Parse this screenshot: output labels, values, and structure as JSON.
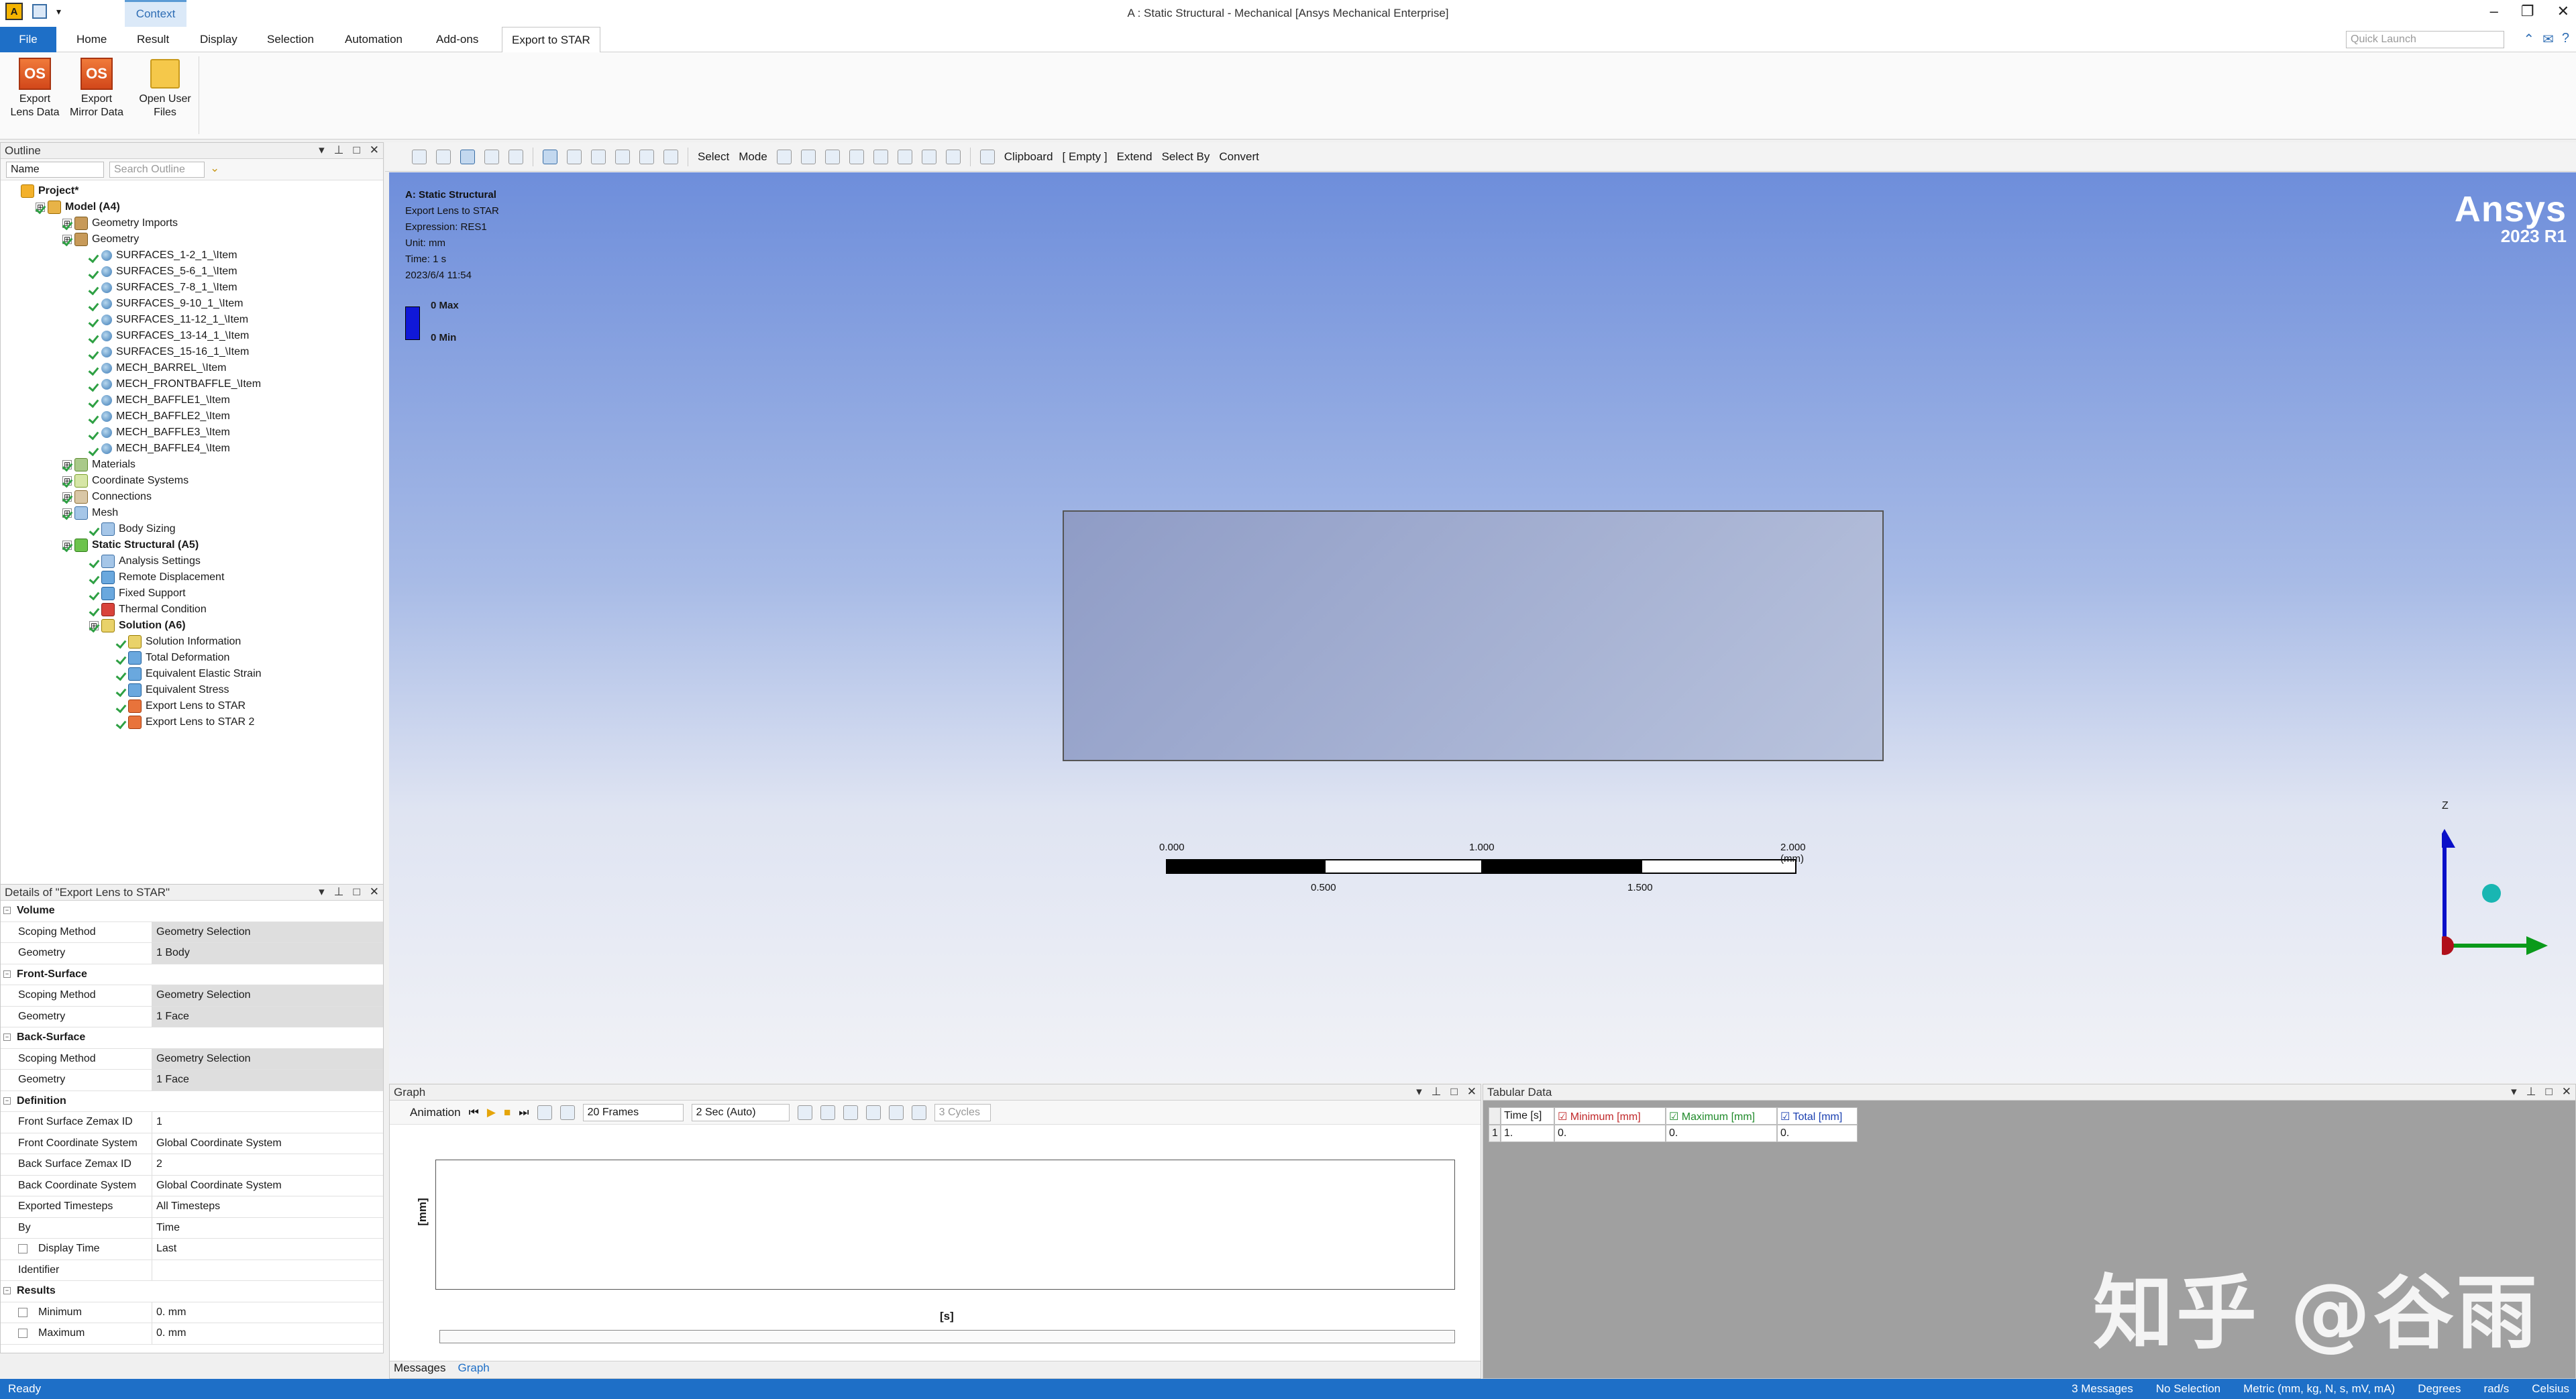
{
  "window": {
    "title": "A : Static Structural - Mechanical [Ansys Mechanical Enterprise]",
    "context_tab": "Context"
  },
  "ribbon_tabs": [
    "File",
    "Home",
    "Result",
    "Display",
    "Selection",
    "Automation",
    "Add-ons",
    "Export to STAR"
  ],
  "quick_launch_placeholder": "Quick Launch",
  "ribbon": {
    "btn1_l1": "Export",
    "btn1_l2": "Lens Data",
    "btn2_l1": "Export",
    "btn2_l2": "Mirror Data",
    "btn3_l1": "Open User",
    "btn3_l2": "Files",
    "os_icon": "OS"
  },
  "outline": {
    "title": "Outline",
    "filter_name": "Name",
    "search_placeholder": "Search Outline",
    "items": [
      "Project*",
      "Model (A4)",
      "Geometry Imports",
      "Geometry",
      "SURFACES_1-2_1_\\Item",
      "SURFACES_5-6_1_\\Item",
      "SURFACES_7-8_1_\\Item",
      "SURFACES_9-10_1_\\Item",
      "SURFACES_11-12_1_\\Item",
      "SURFACES_13-14_1_\\Item",
      "SURFACES_15-16_1_\\Item",
      "MECH_BARREL_\\Item",
      "MECH_FRONTBAFFLE_\\Item",
      "MECH_BAFFLE1_\\Item",
      "MECH_BAFFLE2_\\Item",
      "MECH_BAFFLE3_\\Item",
      "MECH_BAFFLE4_\\Item",
      "Materials",
      "Coordinate Systems",
      "Connections",
      "Mesh",
      "Body Sizing",
      "Static Structural (A5)",
      "Analysis Settings",
      "Remote Displacement",
      "Fixed Support",
      "Thermal Condition",
      "Solution (A6)",
      "Solution Information",
      "Total Deformation",
      "Equivalent Elastic Strain",
      "Equivalent Stress",
      "Export Lens to STAR",
      "Export Lens to STAR 2"
    ]
  },
  "details": {
    "title": "Details of \"Export Lens to STAR\"",
    "rows": [
      {
        "k": "Volume",
        "v": ""
      },
      {
        "k": "Scoping Method",
        "v": "Geometry Selection"
      },
      {
        "k": "Geometry",
        "v": "1 Body"
      },
      {
        "k": "Front-Surface",
        "v": ""
      },
      {
        "k": "Scoping Method",
        "v": "Geometry Selection"
      },
      {
        "k": "Geometry",
        "v": "1 Face"
      },
      {
        "k": "Back-Surface",
        "v": ""
      },
      {
        "k": "Scoping Method",
        "v": "Geometry Selection"
      },
      {
        "k": "Geometry",
        "v": "1 Face"
      },
      {
        "k": "Definition",
        "v": ""
      },
      {
        "k": "Front Surface Zemax ID",
        "v": "1"
      },
      {
        "k": "Front Coordinate System",
        "v": "Global Coordinate System"
      },
      {
        "k": "Back Surface Zemax ID",
        "v": "2"
      },
      {
        "k": "Back Coordinate System",
        "v": "Global Coordinate System"
      },
      {
        "k": "Exported Timesteps",
        "v": "All Timesteps"
      },
      {
        "k": "By",
        "v": "Time"
      },
      {
        "k": "Display Time",
        "v": "Last"
      },
      {
        "k": "Identifier",
        "v": ""
      },
      {
        "k": "Results",
        "v": ""
      },
      {
        "k": "Minimum",
        "v": "0. mm"
      },
      {
        "k": "Maximum",
        "v": "0. mm"
      }
    ]
  },
  "toolbar": {
    "select": "Select",
    "mode": "Mode",
    "clipboard": "Clipboard",
    "empty": "[ Empty ]",
    "extend": "Extend",
    "select_by": "Select By",
    "convert": "Convert"
  },
  "viewport": {
    "info": [
      "A: Static Structural",
      "Export Lens to STAR",
      "Expression: RES1",
      "Unit: mm",
      "Time: 1 s",
      "2023/6/4 11:54"
    ],
    "legend_max": "0 Max",
    "legend_min": "0 Min",
    "brand": "Ansys",
    "version": "2023 R1",
    "scale_labels": [
      "0.000",
      "1.000",
      "2.000 (mm)",
      "0.500",
      "1.500"
    ],
    "axis_z": "Z"
  },
  "graph": {
    "title": "Graph",
    "animation": "Animation",
    "frames": "20 Frames",
    "duration": "2 Sec (Auto)",
    "cycles": "3 Cycles",
    "ylabel": "[mm]",
    "xlabel": "[s]",
    "tab_messages": "Messages",
    "tab_graph": "Graph"
  },
  "tabular": {
    "title": "Tabular Data",
    "headers": [
      "Time [s]",
      "Minimum [mm]",
      "Maximum [mm]",
      "Total [mm]"
    ],
    "row_num": "1",
    "row": [
      "1.",
      "0.",
      "0.",
      "0."
    ]
  },
  "status": {
    "ready": "Ready",
    "messages": "3 Messages",
    "selection": "No Selection",
    "units": "Metric (mm, kg, N, s, mV, mA)",
    "angle": "Degrees",
    "rot": "rad/s",
    "temp": "Celsius"
  },
  "watermark": "知乎 @谷雨"
}
